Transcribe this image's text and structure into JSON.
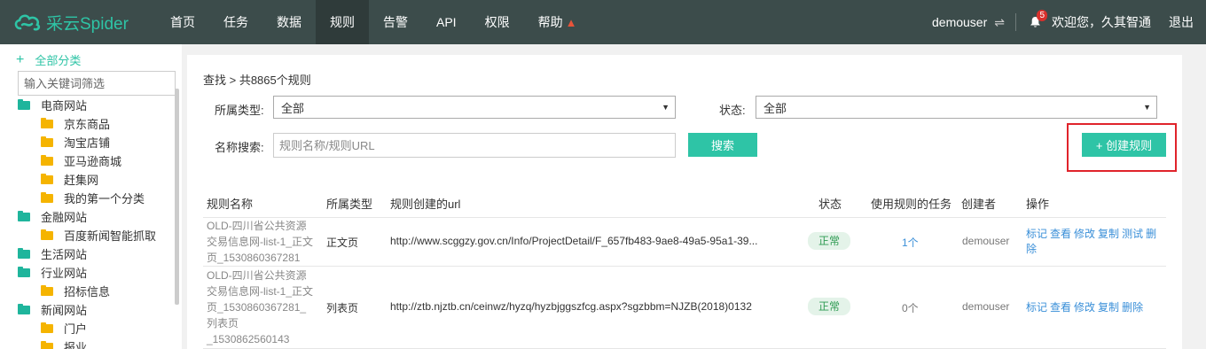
{
  "app": {
    "logo_text": "采云Spider",
    "accent": "#2ec4a6"
  },
  "nav": {
    "items": [
      "首页",
      "任务",
      "数据",
      "规则",
      "告警",
      "API",
      "权限",
      "帮助"
    ],
    "active": "规则"
  },
  "user": {
    "name": "demouser",
    "swap_icon": "⇌",
    "notif_count": "5",
    "welcome": "欢迎您，久其智通",
    "logout": "退出"
  },
  "sidebar": {
    "all_label": "全部分类",
    "filter_placeholder": "输入关键词筛选",
    "items": [
      {
        "label": "电商网站",
        "level": 0
      },
      {
        "label": "京东商品",
        "level": 1
      },
      {
        "label": "淘宝店铺",
        "level": 1
      },
      {
        "label": "亚马逊商城",
        "level": 1
      },
      {
        "label": "赶集网",
        "level": 1
      },
      {
        "label": "我的第一个分类",
        "level": 1
      },
      {
        "label": "金融网站",
        "level": 0
      },
      {
        "label": "百度新闻智能抓取",
        "level": 1
      },
      {
        "label": "生活网站",
        "level": 0
      },
      {
        "label": "行业网站",
        "level": 0
      },
      {
        "label": "招标信息",
        "level": 1
      },
      {
        "label": "新闻网站",
        "level": 0
      },
      {
        "label": "门户",
        "level": 1
      },
      {
        "label": "报业",
        "level": 1
      }
    ]
  },
  "main": {
    "breadcrumb": "查找 > 共8865个规则",
    "type_label": "所属类型:",
    "type_value": "全部",
    "status_label": "状态:",
    "status_value": "全部",
    "name_label": "名称搜索:",
    "name_placeholder": "规则名称/规则URL",
    "search_button": "搜索",
    "create_button": "+ 创建规则"
  },
  "table": {
    "headers": [
      "规则名称",
      "所属类型",
      "规则创建的url",
      "状态",
      "使用规则的任务",
      "创建者",
      "操作"
    ],
    "rows": [
      {
        "name_lines": [
          "OLD-四川省公共资源",
          "交易信息网-list-1_正文",
          "页_1530860367281"
        ],
        "type": "正文页",
        "url": "http://www.scggzy.gov.cn/Info/ProjectDetail/F_657fb483-9ae8-49a5-95a1-39...",
        "status": "正常",
        "tasks": "1个",
        "creator": "demouser",
        "ops": [
          "标记",
          "查看",
          "修改",
          "复制",
          "测试",
          "删除"
        ]
      },
      {
        "name_lines": [
          "OLD-四川省公共资源",
          "交易信息网-list-1_正文",
          "页_1530860367281_",
          "列表页",
          "_1530862560143"
        ],
        "type": "列表页",
        "url": "http://ztb.njztb.cn/ceinwz/hyzq/hyzbjggszfcg.aspx?sgzbbm=NJZB(2018)0132",
        "status": "正常",
        "tasks": "0个",
        "creator": "demouser",
        "ops": [
          "标记",
          "查看",
          "修改",
          "复制",
          "删除"
        ]
      }
    ]
  }
}
